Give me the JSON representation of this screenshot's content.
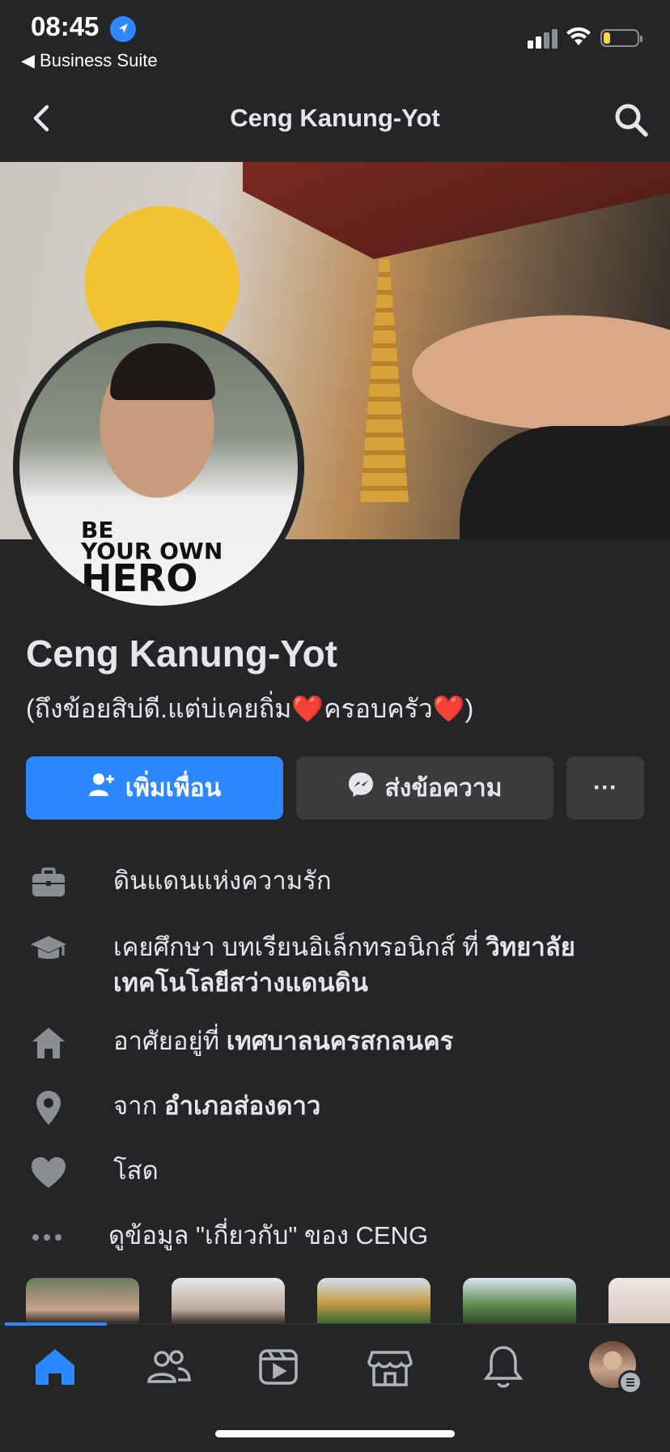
{
  "status_bar": {
    "time": "08:45",
    "back_app_label": "◀ Business Suite"
  },
  "header": {
    "title": "Ceng Kanung-Yot"
  },
  "profile": {
    "name": "Ceng Kanung-Yot",
    "bio": "(ถึงข้อยสิบ่ดี.แต่บ่เคยถิ่ม❤️ครอบครัว❤️)",
    "profile_photo_text": [
      "BE",
      "YOUR OWN",
      "HERO"
    ]
  },
  "actions": {
    "add_friend_label": "เพิ่มเพื่อน",
    "message_label": "ส่งข้อความ",
    "more_label": "···"
  },
  "info": [
    {
      "icon": "briefcase-icon",
      "text": "ดินแดนแห่งความรัก",
      "bold": ""
    },
    {
      "icon": "graduation-cap-icon",
      "text": "เคยศึกษา บทเรียนอิเล็กทรอนิกส์ ที่ ",
      "bold": "วิทยาลัยเทคโนโลยีสว่างแดนดิน"
    },
    {
      "icon": "home-icon",
      "text": "อาศัยอยู่ที่ ",
      "bold": "เทศบาลนครสกลนคร"
    },
    {
      "icon": "location-pin-icon",
      "text": "จาก ",
      "bold": "อำเภอส่องดาว"
    },
    {
      "icon": "heart-icon",
      "text": "โสด",
      "bold": ""
    },
    {
      "icon": "more-dots-icon",
      "text": "ดูข้อมูล \"เกี่ยวกับ\" ของ CENG",
      "bold": ""
    }
  ],
  "tabs": [
    "home-icon",
    "friends-icon",
    "video-icon",
    "marketplace-icon",
    "notifications-icon",
    "profile-avatar"
  ],
  "colors": {
    "background": "#242526",
    "accent": "#2d88ff",
    "button_secondary": "#3a3b3c",
    "text": "#e4e6eb"
  }
}
